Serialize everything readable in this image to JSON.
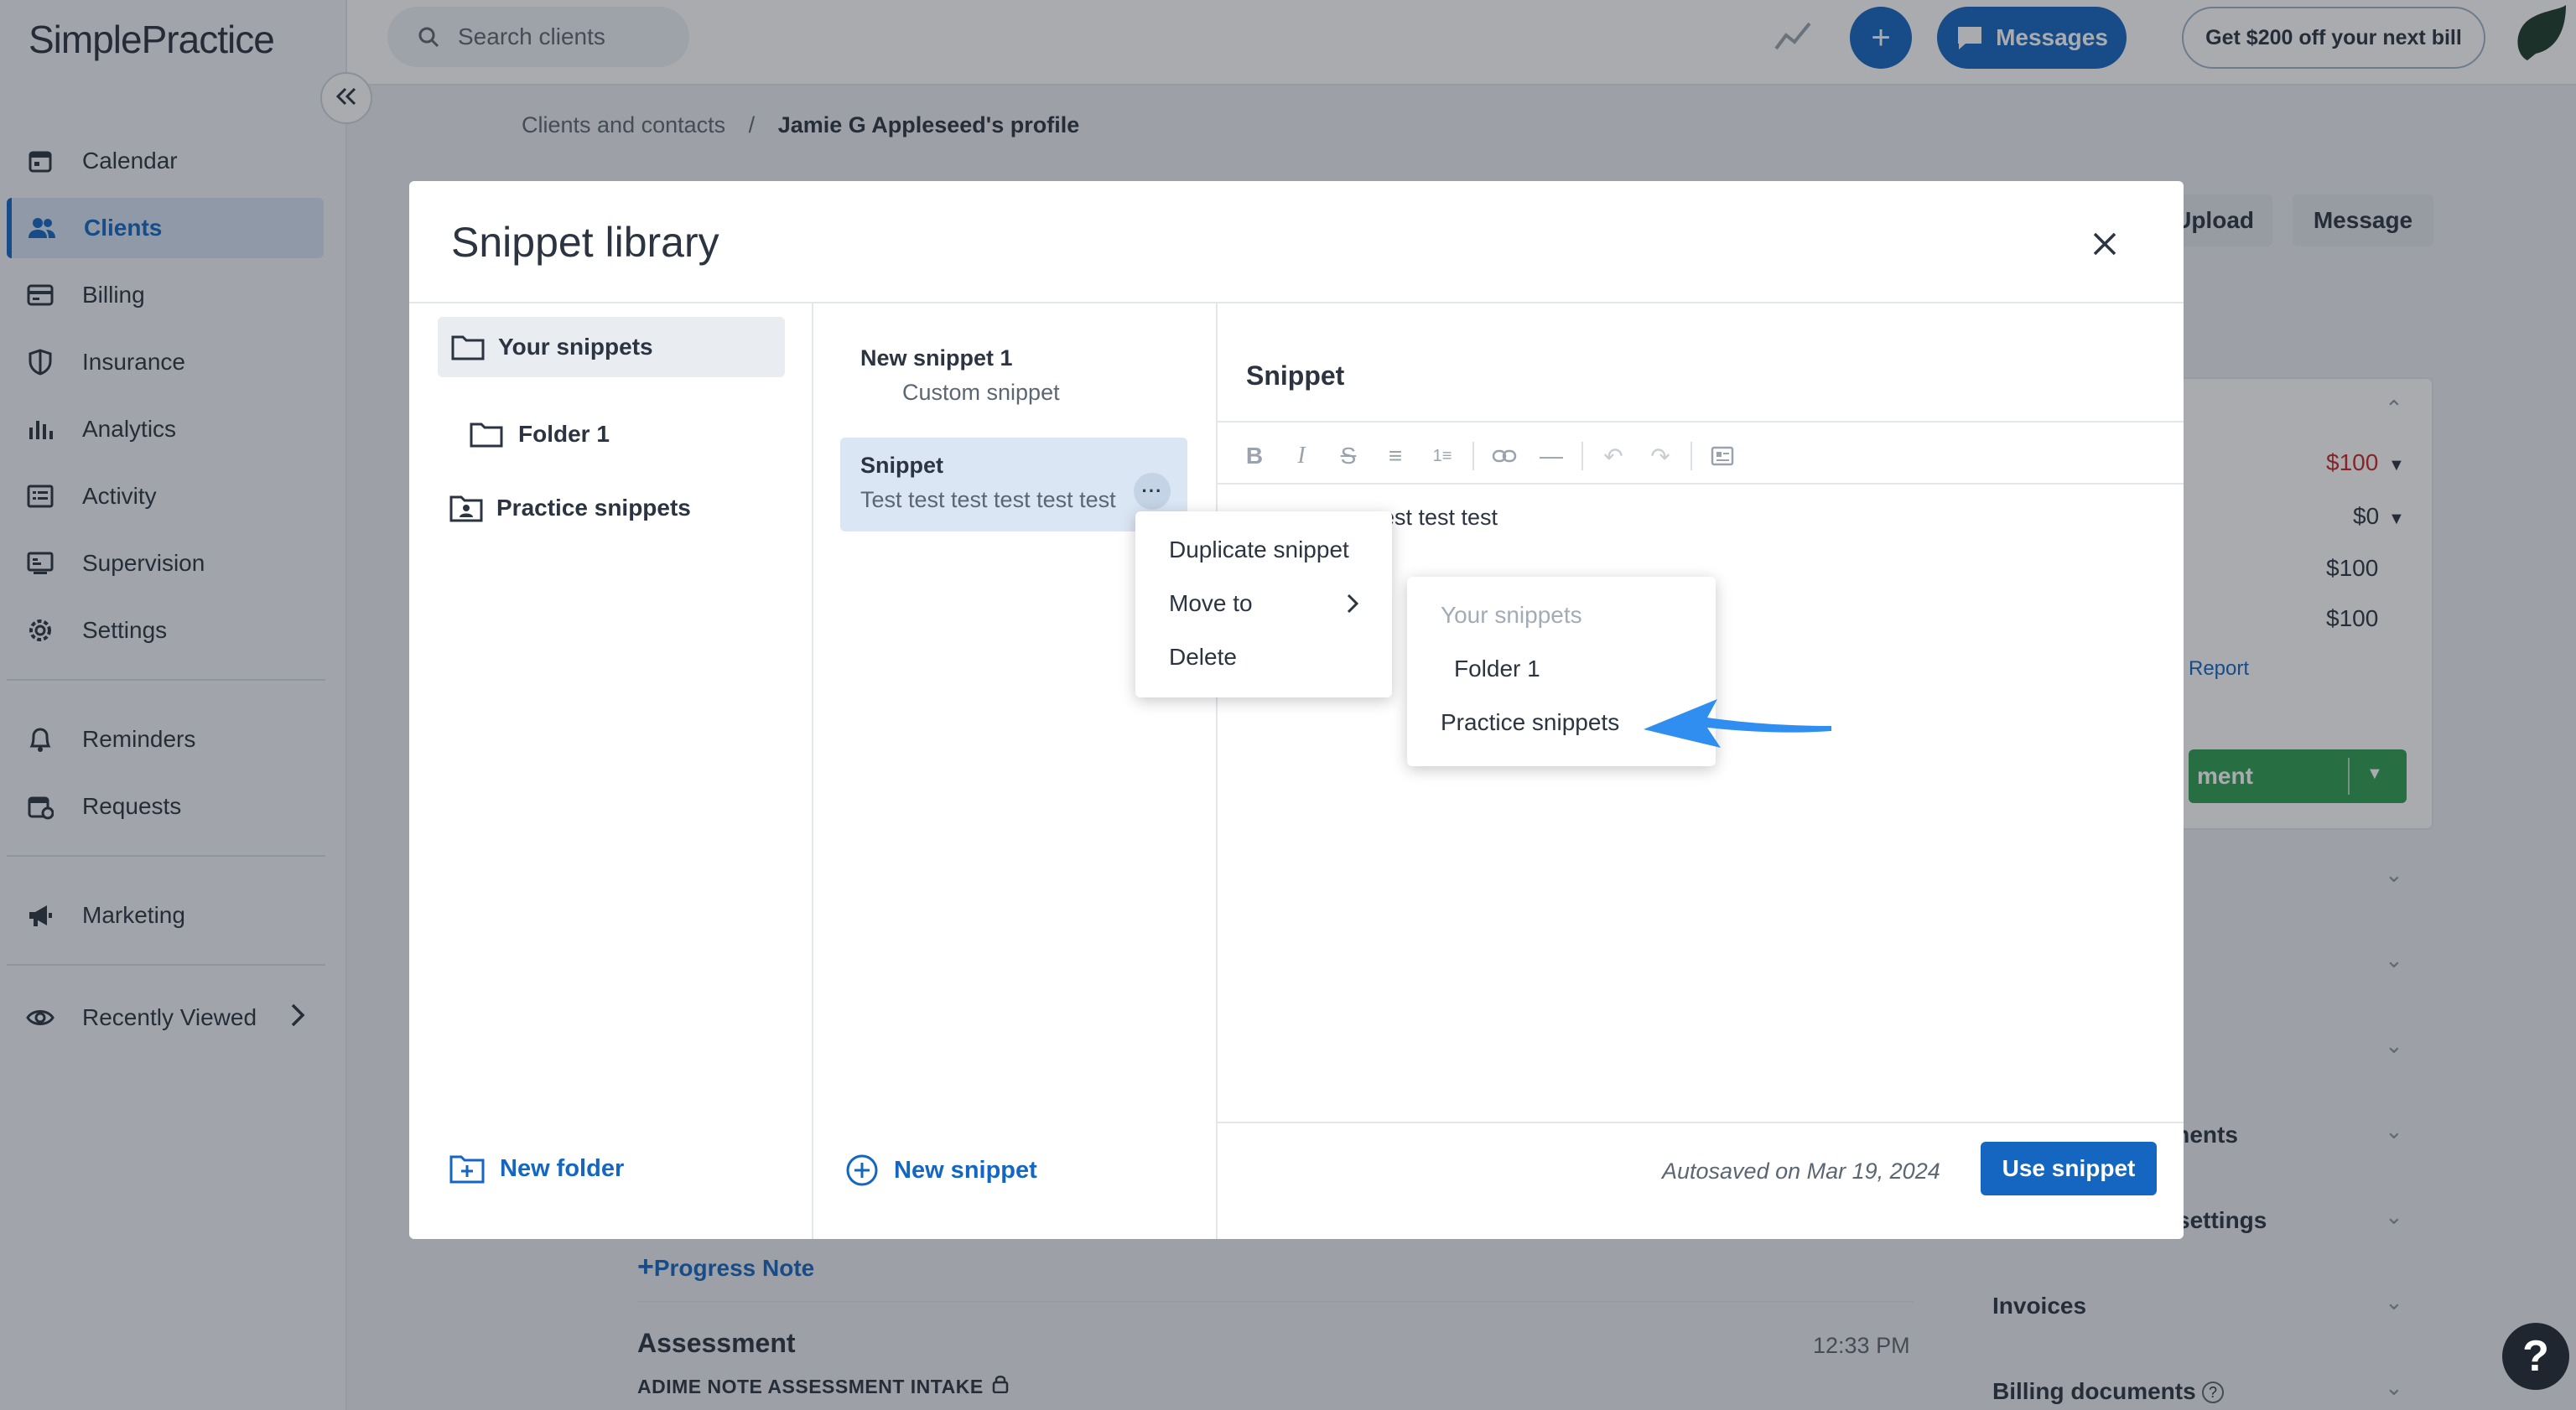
{
  "app": {
    "logo": "SimplePractice"
  },
  "sidebar": {
    "items": [
      {
        "label": "Calendar",
        "icon": "calendar-icon"
      },
      {
        "label": "Clients",
        "icon": "users-icon",
        "active": true
      },
      {
        "label": "Billing",
        "icon": "card-icon"
      },
      {
        "label": "Insurance",
        "icon": "shield-icon"
      },
      {
        "label": "Analytics",
        "icon": "bar-chart-icon"
      },
      {
        "label": "Activity",
        "icon": "list-icon"
      },
      {
        "label": "Supervision",
        "icon": "supervision-icon"
      },
      {
        "label": "Settings",
        "icon": "gear-icon"
      }
    ],
    "secondary": [
      {
        "label": "Reminders",
        "icon": "bell-icon"
      },
      {
        "label": "Requests",
        "icon": "calendar-request-icon"
      }
    ],
    "marketing": {
      "label": "Marketing",
      "icon": "megaphone-icon"
    },
    "recent": {
      "label": "Recently Viewed",
      "icon": "eye-icon"
    }
  },
  "topbar": {
    "search_placeholder": "Search clients",
    "messages_label": "Messages",
    "promo_label": "Get $200 off your next bill"
  },
  "breadcrumb": {
    "parent": "Clients and contacts",
    "separator": "/",
    "current": "Jamie G Appleseed's profile"
  },
  "page_bg": {
    "upload_label": "Upload",
    "message_label": "Message",
    "billing_rows": [
      {
        "value": "$100"
      },
      {
        "value": "$0"
      },
      {
        "value": "$100"
      },
      {
        "value": "$100"
      }
    ],
    "report_link": "Report",
    "payment_button": "ment",
    "sections": [
      "ntments",
      "settings",
      "Invoices",
      "Billing documents"
    ],
    "progress_note_link": "Progress Note",
    "assessment_title": "Assessment",
    "assessment_time": "12:33 PM",
    "assessment_subtitle": "ADIME NOTE ASSESSMENT INTAKE"
  },
  "modal": {
    "title": "Snippet library",
    "folders": [
      {
        "label": "Your snippets",
        "selected": true
      },
      {
        "label": "Folder 1"
      },
      {
        "label": "Practice snippets"
      }
    ],
    "new_folder_label": "New folder",
    "snippets": [
      {
        "title": "New snippet 1",
        "subtitle": "Custom snippet"
      },
      {
        "title": "Snippet",
        "subtitle": "Test test test test test test",
        "selected": true
      }
    ],
    "new_snippet_label": "New snippet",
    "editor": {
      "title": "Snippet",
      "body_visible": "est test test",
      "autosave": "Autosaved on Mar 19, 2024",
      "use_button": "Use snippet"
    }
  },
  "context_menu": {
    "items": [
      "Duplicate snippet",
      "Move to",
      "Delete"
    ]
  },
  "submenu": {
    "items": [
      {
        "label": "Your snippets",
        "disabled": true
      },
      {
        "label": "Folder 1"
      },
      {
        "label": "Practice snippets"
      }
    ]
  },
  "colors": {
    "accent": "#1466c0",
    "annotation_arrow": "#2f8ef0",
    "alert_red": "#c62828",
    "success_green": "#2e9e4f"
  }
}
